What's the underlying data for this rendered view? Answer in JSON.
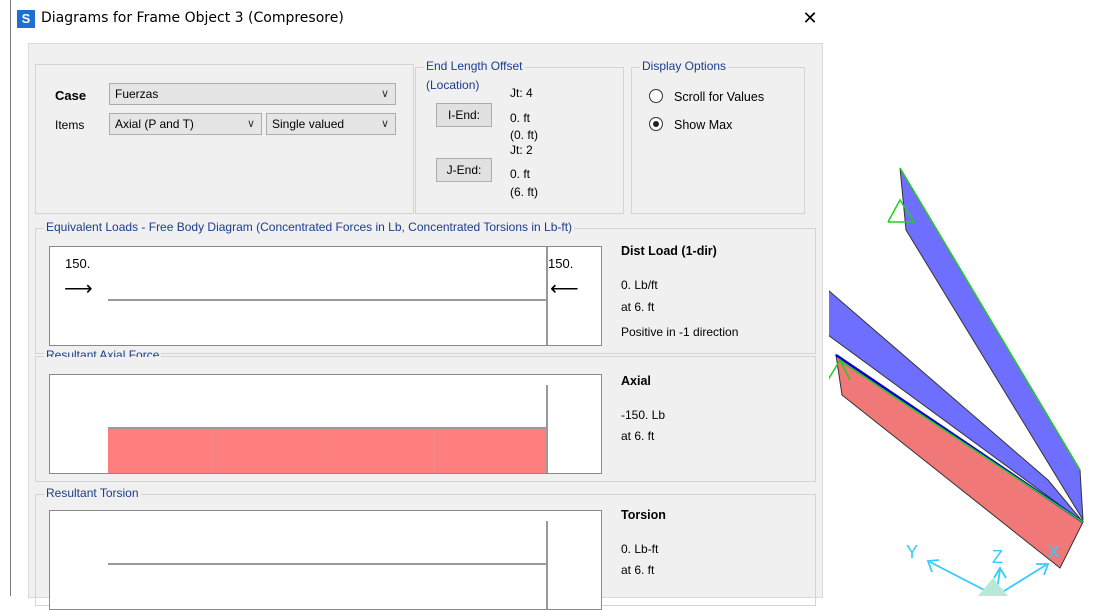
{
  "window": {
    "app_icon": "S",
    "title": "Diagrams for Frame Object 3  (Compresore)",
    "close": "✕"
  },
  "case_section": {
    "case_label": "Case",
    "case_value": "Fuerzas",
    "items_label": "Items",
    "items_value": "Axial (P and T)",
    "valued_value": "Single valued"
  },
  "end_offset": {
    "title": "End Length Offset",
    "subtitle": "(Location)",
    "i_end": {
      "button": "I-End:",
      "jt": "Jt:  4",
      "value": "0. ft",
      "location": "(0. ft)"
    },
    "j_end": {
      "button": "J-End:",
      "jt": "Jt:  2",
      "value": "0. ft",
      "location": "(6. ft)"
    }
  },
  "display_options": {
    "title": "Display Options",
    "options": [
      {
        "label": "Scroll for Values",
        "selected": false
      },
      {
        "label": "Show Max",
        "selected": true
      }
    ]
  },
  "free_body": {
    "title": "Equivalent Loads - Free Body Diagram  (Concentrated Forces in Lb, Concentrated Torsions in Lb-ft)",
    "left_value": "150.",
    "right_value": "150.",
    "info_title": "Dist Load (1-dir)",
    "info_value": "0. Lb/ft",
    "info_at": "at 6. ft",
    "info_note": "Positive in -1 direction"
  },
  "axial": {
    "title": "Resultant Axial Force",
    "info_title": "Axial",
    "info_value": "-150. Lb",
    "info_at": "at 6. ft",
    "fill_color": "#ff7f7f",
    "fill_fraction": 1.0
  },
  "torsion": {
    "title": "Resultant Torsion",
    "info_title": "Torsion",
    "info_value": "0. Lb-ft",
    "info_at": "at 6. ft"
  },
  "viewport": {
    "axis_labels": [
      "Y",
      "Z",
      "X"
    ],
    "colors": {
      "member_blue": "#6a6aff",
      "member_red": "#f07878",
      "edge_green": "#22cc22",
      "axis_cyan": "#33ccff"
    }
  }
}
